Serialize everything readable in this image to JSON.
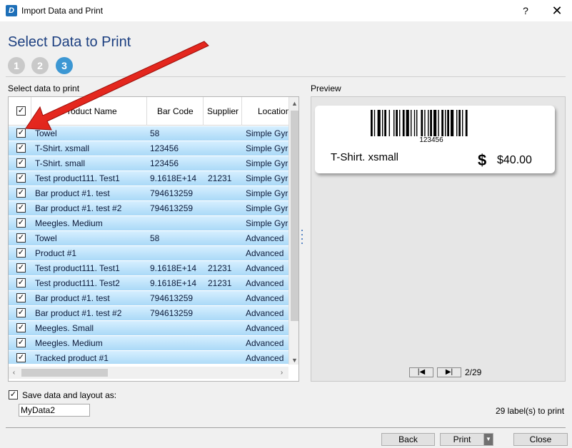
{
  "window": {
    "title": "Import Data and Print",
    "help": "?",
    "close": "✕"
  },
  "heading": "Select Data to Print",
  "steps": [
    "1",
    "2",
    "3"
  ],
  "select_label": "Select data to print",
  "preview_label": "Preview",
  "grid": {
    "columns": [
      "Product Name",
      "Bar Code",
      "Supplier",
      "Location"
    ],
    "rows": [
      {
        "name": "Towel",
        "barcode": "58",
        "supplier": "",
        "location": "Simple Gyr"
      },
      {
        "name": "T-Shirt. xsmall",
        "barcode": "123456",
        "supplier": "",
        "location": "Simple Gyr"
      },
      {
        "name": "T-Shirt. small",
        "barcode": "123456",
        "supplier": "",
        "location": "Simple Gyr"
      },
      {
        "name": "Test product111. Test1",
        "barcode": "9.1618E+14",
        "supplier": "21231",
        "location": "Simple Gyr"
      },
      {
        "name": "Bar product #1. test",
        "barcode": "794613259",
        "supplier": "",
        "location": "Simple Gyr"
      },
      {
        "name": "Bar product #1. test #2",
        "barcode": "794613259",
        "supplier": "",
        "location": "Simple Gyr"
      },
      {
        "name": "Meegles. Medium",
        "barcode": "",
        "supplier": "",
        "location": "Simple Gyr"
      },
      {
        "name": "Towel",
        "barcode": "58",
        "supplier": "",
        "location": "Advanced"
      },
      {
        "name": "Product #1",
        "barcode": "",
        "supplier": "",
        "location": "Advanced"
      },
      {
        "name": "Test product111. Test1",
        "barcode": "9.1618E+14",
        "supplier": "21231",
        "location": "Advanced"
      },
      {
        "name": "Test product111. Test2",
        "barcode": "9.1618E+14",
        "supplier": "21231",
        "location": "Advanced"
      },
      {
        "name": "Bar product #1. test",
        "barcode": "794613259",
        "supplier": "",
        "location": "Advanced"
      },
      {
        "name": "Bar product #1. test #2",
        "barcode": "794613259",
        "supplier": "",
        "location": "Advanced"
      },
      {
        "name": "Meegles. Small",
        "barcode": "",
        "supplier": "",
        "location": "Advanced"
      },
      {
        "name": "Meegles. Medium",
        "barcode": "",
        "supplier": "",
        "location": "Advanced"
      },
      {
        "name": "Tracked product #1",
        "barcode": "",
        "supplier": "",
        "location": "Advanced"
      }
    ]
  },
  "preview": {
    "barcode_number": "123456",
    "product_name": "T-Shirt. xsmall",
    "currency_symbol": "$",
    "price": "$40.00",
    "page_indicator": "2/29"
  },
  "save": {
    "checkbox_label": "Save data and layout as:",
    "checked": true,
    "value": "MyData2"
  },
  "labels_to_print": "29 label(s) to print",
  "buttons": {
    "back": "Back",
    "print": "Print",
    "close": "Close"
  },
  "colors": {
    "heading": "#1c3f80",
    "step_active": "#3c97d3",
    "row_highlight": "#c0e4fb",
    "annotation_arrow": "#e8201a"
  }
}
